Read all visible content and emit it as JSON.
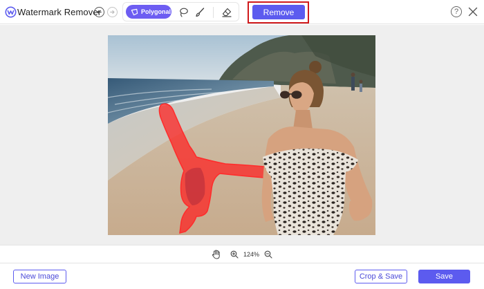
{
  "app": {
    "title": "Watermark Remover"
  },
  "toolbar": {
    "polygonal_label": "Polygonal",
    "remove_label": "Remove"
  },
  "help": {
    "label": "?"
  },
  "zoom": {
    "level": "124%"
  },
  "footer": {
    "new_image_label": "New Image",
    "crop_save_label": "Crop & Save",
    "save_label": "Save"
  },
  "icons": {
    "logo": "watermark-logo-icon",
    "undo": "undo-icon",
    "redo": "redo-icon",
    "polygonal": "polygon-icon",
    "lasso": "lasso-icon",
    "brush": "brush-icon",
    "eraser": "eraser-icon",
    "help": "help-icon",
    "close": "close-icon",
    "hand": "hand-icon",
    "zoom_in": "zoom-in-icon",
    "zoom_out": "zoom-out-icon"
  },
  "colors": {
    "accent": "#5c5bef",
    "highlight": "#d0191b",
    "mask": "#ff1e1e"
  }
}
